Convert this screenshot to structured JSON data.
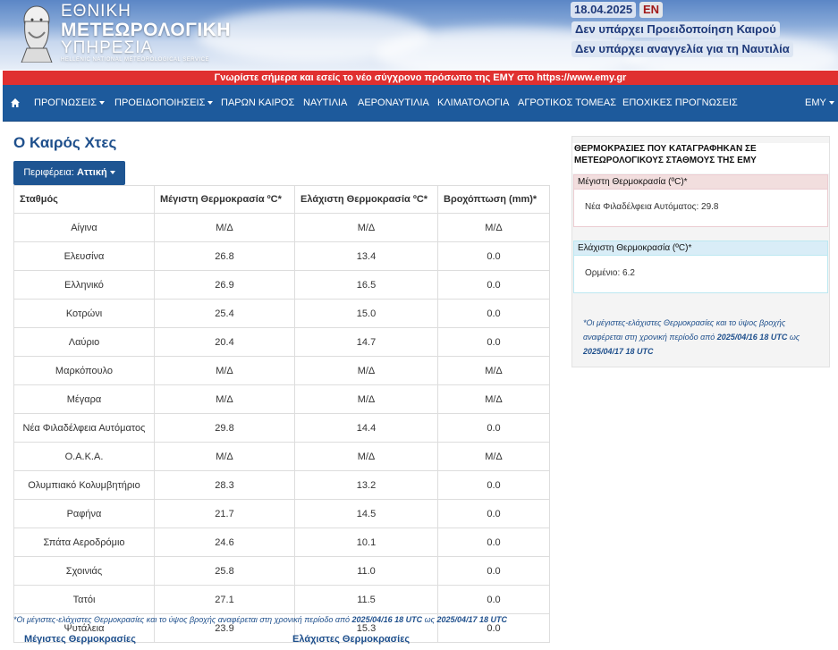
{
  "header": {
    "logo_line1": "ΕΘΝΙΚΗ",
    "logo_line2": "ΜΕΤΕΩΡΟΛΟΓΙΚΗ",
    "logo_line3": "ΥΠΗΡΕΣΙΑ",
    "logo_line4": "HELLENIC NATIONAL METEOROLOGICAL SERVICE",
    "date": "18.04.2025",
    "lang": "EN",
    "warning_weather": "Δεν υπάρχει Προειδοποίηση Καιρού",
    "warning_nautical": "Δεν υπάρχει αναγγελία για τη Ναυτιλία"
  },
  "announcement": "Γνωρίστε σήμερα και εσείς το νέο σύγχρονο πρόσωπο της ΕΜΥ στο https://www.emy.gr",
  "nav": {
    "home_icon": "home-icon",
    "items": [
      {
        "label": "ΠΡΟΓΝΩΣΕΙΣ",
        "dropdown": true
      },
      {
        "label": "ΠΡΟΕΙΔΟΠΟΙΗΣΕΙΣ",
        "dropdown": true
      },
      {
        "label": "ΠΑΡΩΝ ΚΑΙΡΟΣ",
        "dropdown": false
      },
      {
        "label": "ΝΑΥΤΙΛΙΑ",
        "dropdown": false
      },
      {
        "label": "ΑΕΡΟΝΑΥΤΙΛΙΑ",
        "dropdown": false
      },
      {
        "label": "ΚΛΙΜΑΤΟΛΟΓΙΑ",
        "dropdown": false
      },
      {
        "label": "ΑΓΡΟΤΙΚΟΣ ΤΟΜΕΑΣ",
        "dropdown": false
      },
      {
        "label": "ΕΠΟΧΙΚΕΣ ΠΡΟΓΝΩΣΕΙΣ",
        "dropdown": false
      }
    ],
    "right_label": "ΕΜΥ"
  },
  "main": {
    "title": "Ο Καιρός Χτες",
    "region_prefix": "Περιφέρεια: ",
    "region_value": "Αττική",
    "columns": [
      "Σταθμός",
      "Μέγιστη Θερμοκρασία ºC*",
      "Ελάχιστη Θερμοκρασία ºC*",
      "Βροχόπτωση (mm)*"
    ],
    "rows": [
      [
        "Αίγινα",
        "Μ/Δ",
        "Μ/Δ",
        "Μ/Δ"
      ],
      [
        "Ελευσίνα",
        "26.8",
        "13.4",
        "0.0"
      ],
      [
        "Ελληνικό",
        "26.9",
        "16.5",
        "0.0"
      ],
      [
        "Κοτρώνι",
        "25.4",
        "15.0",
        "0.0"
      ],
      [
        "Λαύριο",
        "20.4",
        "14.7",
        "0.0"
      ],
      [
        "Μαρκόπουλο",
        "Μ/Δ",
        "Μ/Δ",
        "Μ/Δ"
      ],
      [
        "Μέγαρα",
        "Μ/Δ",
        "Μ/Δ",
        "Μ/Δ"
      ],
      [
        "Νέα Φιλαδέλφεια Αυτόματος",
        "29.8",
        "14.4",
        "0.0"
      ],
      [
        "Ο.Α.Κ.Α.",
        "Μ/Δ",
        "Μ/Δ",
        "Μ/Δ"
      ],
      [
        "Ολυμπιακό Κολυμβητήριο",
        "28.3",
        "13.2",
        "0.0"
      ],
      [
        "Ραφήνα",
        "21.7",
        "14.5",
        "0.0"
      ],
      [
        "Σπάτα Αεροδρόμιο",
        "24.6",
        "10.1",
        "0.0"
      ],
      [
        "Σχοινιάς",
        "25.8",
        "11.0",
        "0.0"
      ],
      [
        "Τατόι",
        "27.1",
        "11.5",
        "0.0"
      ],
      [
        "Ψυτάλεια",
        "23.9",
        "15.3",
        "0.0"
      ]
    ],
    "footnote_text": "*Οι μέγιστες-ελάχιστες Θερμοκρασίες και το ύψος βροχής αναφέρεται στη χρονική περίοδο από ",
    "footnote_from": "2025/04/16 18 UTC",
    "footnote_mid": " ως ",
    "footnote_to": "2025/04/17 18 UTC",
    "bottom_left": "Μέγιστες Θερμοκρασίες",
    "bottom_right": "Ελάχιστες Θερμοκρασίες"
  },
  "sidebar": {
    "title": "ΘΕΡΜΟΚΡΑΣΙΕΣ ΠΟΥ ΚΑΤΑΓΡΑΦΗΚΑΝ ΣΕ ΜΕΤΕΩΡΟΛΟΓΙΚΟΥΣ ΣΤΑΘΜΟΥΣ ΤΗΣ ΕΜΥ",
    "max_label": "Μέγιστη Θερμοκρασία (ºC)*",
    "max_value": "Νέα Φιλαδέλφεια Αυτόματος: 29.8",
    "min_label": "Ελάχιστη Θερμοκρασία (ºC)*",
    "min_value": "Ορμένιο: 6.2",
    "note_text": "*Οι μέγιστες-ελάχιστες Θερμοκρασίες και το ύψος βροχής αναφέρεται στη χρονική περίοδο από ",
    "note_from": "2025/04/16 18 UTC",
    "note_mid": " ως ",
    "note_to": "2025/04/17 18 UTC"
  }
}
